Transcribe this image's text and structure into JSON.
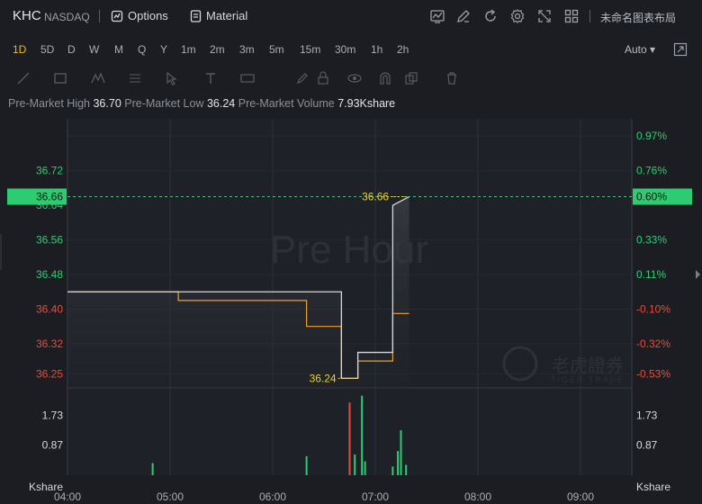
{
  "header": {
    "ticker": "KHC",
    "exchange": "NASDAQ",
    "options_label": "Options",
    "material_label": "Material",
    "layout_name": "未命名图表布局",
    "icons": [
      "line-chart-icon",
      "edit-icon",
      "refresh-icon",
      "gear-icon",
      "expand-icon",
      "grid-icon"
    ]
  },
  "periods": {
    "items": [
      "1D",
      "5D",
      "D",
      "W",
      "M",
      "Q",
      "Y",
      "1m",
      "2m",
      "3m",
      "5m",
      "15m",
      "30m",
      "1h",
      "2h"
    ],
    "active": "1D",
    "scale_label": "Auto ▾"
  },
  "drawing_tools": [
    "line-tool-icon",
    "rect-tool-icon",
    "pattern-tool-icon",
    "fib-tool-icon",
    "cursor-tool-icon",
    "text-tool-icon",
    "measure-tool-icon",
    "pen-icon",
    "lock-icon",
    "eye-icon",
    "magnet-icon",
    "copy-icon",
    "trash-icon"
  ],
  "info": {
    "high_label": "Pre-Market High",
    "high_value": "36.70",
    "low_label": "Pre-Market Low",
    "low_value": "36.24",
    "volume_label": "Pre-Market Volume",
    "volume_value": "7.93Kshare"
  },
  "chart_data": {
    "type": "line",
    "watermark": "Pre Hour",
    "brand_watermark": "老虎證券",
    "brand_watermark_sub": "TIGER TRADE",
    "price_ticks": [
      {
        "label": "36.72",
        "value": 36.72,
        "color": "#2ecc71"
      },
      {
        "label": "36.64",
        "value": 36.64,
        "color": "#2ecc71"
      },
      {
        "label": "36.56",
        "value": 36.56,
        "color": "#2ecc71"
      },
      {
        "label": "36.48",
        "value": 36.48,
        "color": "#2ecc71"
      },
      {
        "label": "36.40",
        "value": 36.4,
        "color": "#e74c3c"
      },
      {
        "label": "36.32",
        "value": 36.32,
        "color": "#e74c3c"
      },
      {
        "label": "36.25",
        "value": 36.25,
        "color": "#e74c3c"
      }
    ],
    "pct_ticks": [
      {
        "label": "0.97%",
        "value": 36.8,
        "color": "#2ecc71"
      },
      {
        "label": "0.76%",
        "value": 36.72,
        "color": "#2ecc71"
      },
      {
        "label": "0.33%",
        "value": 36.56,
        "color": "#2ecc71"
      },
      {
        "label": "0.11%",
        "value": 36.48,
        "color": "#2ecc71"
      },
      {
        "label": "-0.10%",
        "value": 36.4,
        "color": "#e74c3c"
      },
      {
        "label": "-0.32%",
        "value": 36.32,
        "color": "#e74c3c"
      },
      {
        "label": "-0.53%",
        "value": 36.25,
        "color": "#e74c3c"
      }
    ],
    "current_price": {
      "label": "36.66",
      "value": 36.66,
      "pct": "0.60%",
      "color": "#2ecc71"
    },
    "high_marker": {
      "label": "36.66",
      "value": 36.66,
      "time": 7.15
    },
    "low_marker": {
      "label": "36.24",
      "value": 36.24,
      "time": 6.9
    },
    "time_ticks": [
      "04:00",
      "05:00",
      "06:00",
      "07:00",
      "08:00",
      "09:00"
    ],
    "time_tick_values": [
      4,
      5,
      6,
      7,
      8,
      9
    ],
    "xlim": [
      4,
      9.5
    ],
    "ylim": [
      36.22,
      36.84
    ],
    "price_series": {
      "name": "",
      "color": "#d8d8d8",
      "points": [
        [
          4,
          36.44
        ],
        [
          6.67,
          36.44
        ],
        [
          6.67,
          36.24
        ],
        [
          6.83,
          36.24
        ],
        [
          6.83,
          36.3
        ],
        [
          7.17,
          36.3
        ],
        [
          7.17,
          36.64
        ],
        [
          7.33,
          36.66
        ]
      ]
    },
    "avg_series": {
      "name": "",
      "color": "#f0a030",
      "points": [
        [
          4,
          36.44
        ],
        [
          5.08,
          36.44
        ],
        [
          5.08,
          36.42
        ],
        [
          6.33,
          36.42
        ],
        [
          6.33,
          36.36
        ],
        [
          6.67,
          36.36
        ],
        [
          6.67,
          36.24
        ],
        [
          6.83,
          36.24
        ],
        [
          6.83,
          36.28
        ],
        [
          7.17,
          36.28
        ],
        [
          7.17,
          36.39
        ],
        [
          7.33,
          36.39
        ]
      ]
    },
    "volume_label": "Kshare",
    "volume_ticks": [
      {
        "label": "1.73",
        "value": 1.73
      },
      {
        "label": "0.87",
        "value": 0.87
      }
    ],
    "volume_ylim": [
      0,
      2.5
    ],
    "volume_bars": [
      {
        "t": 4.83,
        "v": 0.35,
        "color": "#2ecc71"
      },
      {
        "t": 6.33,
        "v": 0.55,
        "color": "#2ecc71"
      },
      {
        "t": 6.75,
        "v": 2.1,
        "color": "#e74c3c"
      },
      {
        "t": 6.8,
        "v": 0.6,
        "color": "#2ecc71"
      },
      {
        "t": 6.87,
        "v": 2.3,
        "color": "#2ecc71"
      },
      {
        "t": 6.9,
        "v": 0.4,
        "color": "#2ecc71"
      },
      {
        "t": 7.17,
        "v": 0.25,
        "color": "#2ecc71"
      },
      {
        "t": 7.22,
        "v": 0.7,
        "color": "#2ecc71"
      },
      {
        "t": 7.25,
        "v": 1.3,
        "color": "#2ecc71"
      },
      {
        "t": 7.3,
        "v": 0.3,
        "color": "#2ecc71"
      }
    ]
  }
}
